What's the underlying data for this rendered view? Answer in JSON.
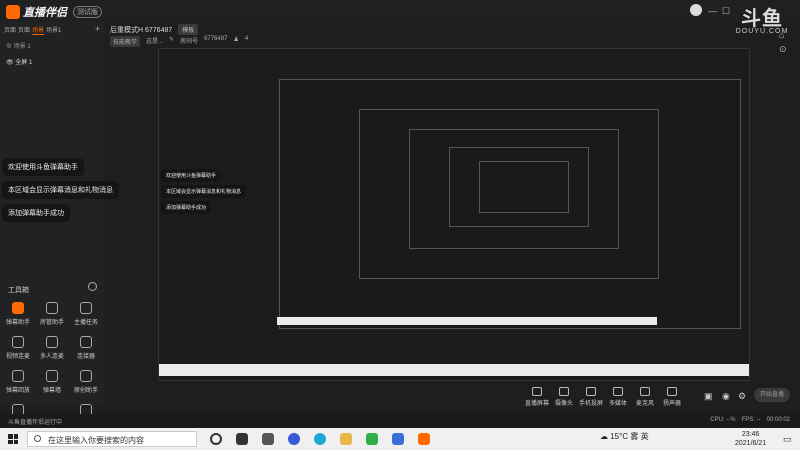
{
  "app": {
    "name": "直播伴侣",
    "beta": "测试版",
    "brand": {
      "big": "斗鱼",
      "small": "DOUYU.COM"
    }
  },
  "left_panel": {
    "scene_tabs": [
      "页面",
      "页面",
      "场景",
      "场景1"
    ],
    "active_tab": 2,
    "tree_label": "⊕ 场景 1",
    "source_label": "全屏 1"
  },
  "stream_info": {
    "title": "后重模式H 6776487",
    "mode_chip": "模板",
    "category": "技能教学",
    "sub": "这是...",
    "room_label": "房间号",
    "room_id": "6776487",
    "fans_count": "4"
  },
  "danmu": [
    "欢迎使用斗鱼弹幕助手",
    "本区域会显示弹幕消息和礼物消息",
    "添加弹幕助手成功"
  ],
  "toolbox": {
    "title": "工具箱",
    "tools": [
      {
        "label": "弹幕助手",
        "icon": "danmu-icon",
        "active": true
      },
      {
        "label": "房管助手",
        "icon": "admin-icon"
      },
      {
        "label": "主播任务",
        "icon": "task-icon"
      },
      {
        "label": "视频连麦",
        "icon": "video-link-icon"
      },
      {
        "label": "多人连麦",
        "icon": "multi-link-icon"
      },
      {
        "label": "连接器",
        "icon": "connector-icon"
      },
      {
        "label": "弹幕回放",
        "icon": "replay-icon"
      },
      {
        "label": "弹幕墙",
        "icon": "wall-icon"
      },
      {
        "label": "原创助手",
        "icon": "original-icon"
      },
      {
        "label": "...",
        "icon": "more-icon"
      },
      {
        "label": "...",
        "icon": "more-icon"
      }
    ]
  },
  "controls": [
    {
      "label": "直播屏幕",
      "icon": "screen-icon"
    },
    {
      "label": "摄像头",
      "icon": "camera-icon"
    },
    {
      "label": "手机投屏",
      "icon": "phone-icon"
    },
    {
      "label": "多媒体",
      "icon": "media-icon"
    },
    {
      "label": "麦克风",
      "icon": "mic-icon"
    },
    {
      "label": "扬声器",
      "icon": "speaker-icon"
    }
  ],
  "go_live": "开始直播",
  "status": {
    "left": "斗鱼直播伴侣运行中",
    "right": [
      "CPU: --%",
      "FPS: --",
      "00:00:02"
    ]
  },
  "taskbar": {
    "search_placeholder": "在这里输入你要搜索的内容",
    "temp": "15°C",
    "weather": "雾",
    "ime": "英",
    "time": "23:46",
    "date": "2021/6/21"
  },
  "preview_nested_taskbar_search": "在这里输入你要搜索的内容"
}
